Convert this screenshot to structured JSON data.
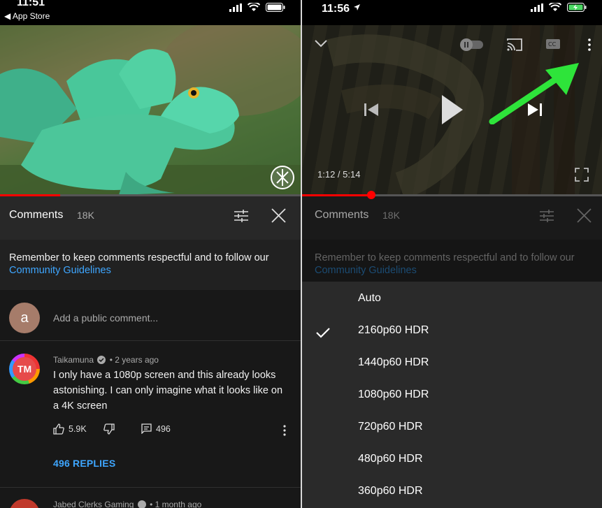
{
  "left": {
    "status": {
      "time": "11:51",
      "back_label": "◀ App Store"
    },
    "comments": {
      "title": "Comments",
      "count": "18K",
      "guideline_text": "Remember to keep comments respectful and to follow our ",
      "guideline_link": "Community Guidelines",
      "add_placeholder": "Add a public comment...",
      "user_initial": "a"
    },
    "comment": {
      "avatar_text": "TM",
      "author": "Taikamuna",
      "age": "• 2 years ago",
      "text": "I only have a 1080p screen and this already looks astonishing. I can only imagine what it looks like on a 4K screen",
      "likes": "5.9K",
      "reply_count": "496",
      "replies_label": "496 REPLIES"
    },
    "next_comment": {
      "author": "Jabed Clerks Gaming",
      "age": "• 1 month ago"
    },
    "video_progress_fraction": 0.2
  },
  "right": {
    "status": {
      "time": "11:56"
    },
    "player": {
      "timecode": "1:12 / 5:14",
      "progress_fraction": 0.23
    },
    "comments": {
      "title": "Comments",
      "count": "18K",
      "guideline_text": "Remember to keep comments respectful and to follow our ",
      "guideline_link": "Community Guidelines"
    },
    "quality_options": [
      {
        "label": "Auto"
      },
      {
        "label": "2160p60 HDR",
        "selected": true
      },
      {
        "label": "1440p60 HDR"
      },
      {
        "label": "1080p60 HDR"
      },
      {
        "label": "720p60 HDR"
      },
      {
        "label": "480p60 HDR"
      },
      {
        "label": "360p60 HDR"
      }
    ]
  },
  "colors": {
    "accent_link": "#3ea6ff",
    "progress": "#ff0000",
    "arrow": "#2ee43a"
  }
}
